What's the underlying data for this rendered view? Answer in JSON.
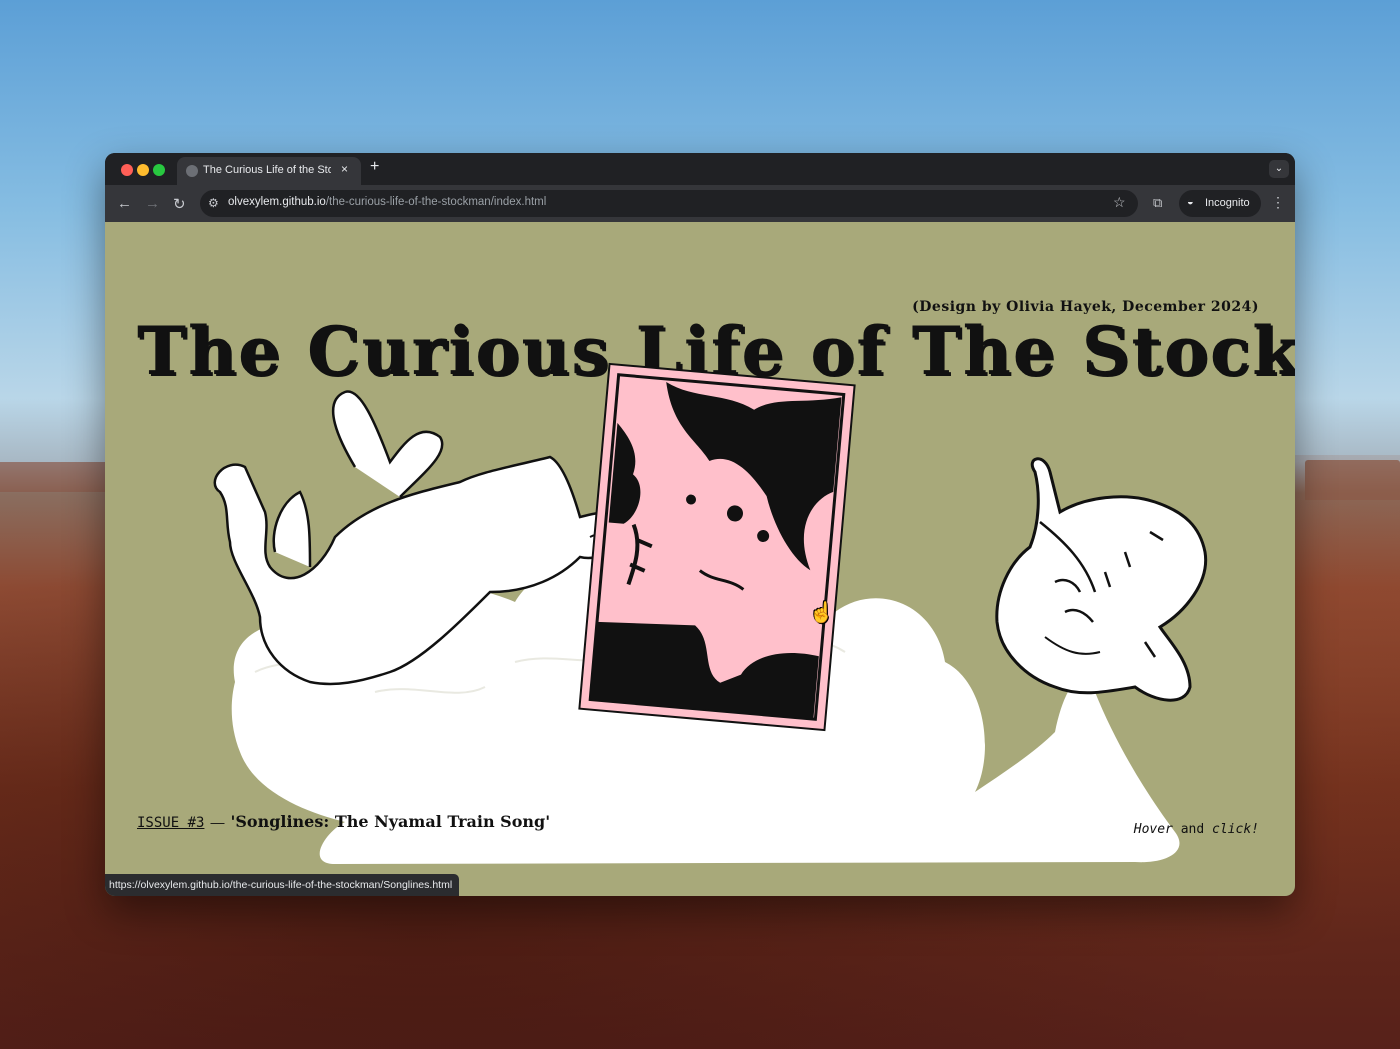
{
  "browser": {
    "tab_title": "The Curious Life of the Stockman",
    "tab_close": "×",
    "new_tab": "+",
    "tab_menu": "⌄",
    "url_host": "olvexylem.github.io",
    "url_path": "/the-curious-life-of-the-stockman/index.html",
    "incognito_label": "Incognito",
    "status_url": "https://olvexylem.github.io/the-curious-life-of-the-stockman/Songlines.html",
    "traffic_lights": [
      "#ff5f57",
      "#febc2e",
      "#28c840"
    ]
  },
  "page": {
    "credit": "(Design by Olivia Hayek, December 2024)",
    "title": "The Curious Life of The Stockman",
    "issue_label": "ISSUE #3",
    "issue_dash": "—",
    "issue_name": "'Songlines: The Nyamal Train Song'",
    "hint_italic_1": "Hover",
    "hint_plain": "and",
    "hint_italic_2": "click!",
    "background_color": "#a8a97a",
    "photo_color": "#ffc0cb"
  },
  "icons": {
    "back": "back-arrow-icon",
    "forward": "forward-arrow-icon",
    "reload": "reload-icon",
    "site_settings": "tune-icon",
    "bookmark": "star-icon",
    "extensions": "extensions-icon",
    "incognito": "incognito-icon",
    "menu": "kebab-menu-icon",
    "cursor": "hand-pointer-icon"
  }
}
